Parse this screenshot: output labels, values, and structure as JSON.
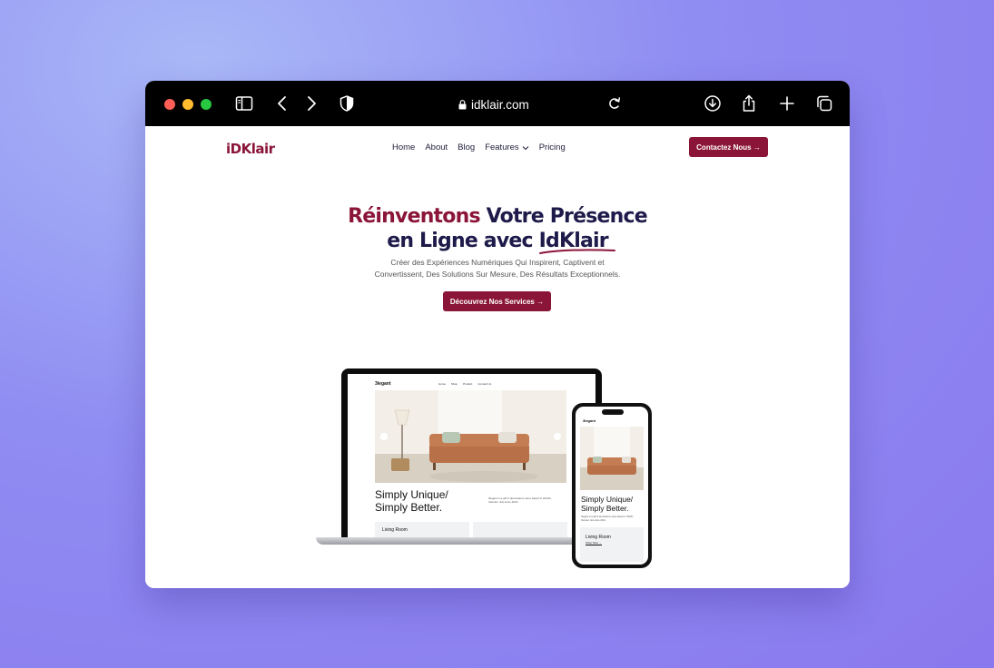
{
  "browser": {
    "url": "idklair.com",
    "traffic_lights": {
      "close": "#ff5f57",
      "minimize": "#febc2e",
      "zoom": "#28c840"
    }
  },
  "site": {
    "logo": "iDKlair",
    "nav": {
      "home": "Home",
      "about": "About",
      "blog": "Blog",
      "features": "Features",
      "pricing": "Pricing"
    },
    "cta_top": "Contactez Nous →",
    "hero": {
      "title_accent": "Réinventons",
      "title_rest_line1": " Votre Présence",
      "title_line2": "en Ligne avec IdKlair",
      "subtitle_line1": "Créer des Expériences Numériques Qui Inspirent, Captivent et",
      "subtitle_line2": "Convertissent, Des Solutions Sur Mesure, Des Résultats Exceptionnels.",
      "cta": "Découvrez Nos Services →"
    },
    "accent_color": "#8b1539",
    "navy_color": "#1e1a4a"
  },
  "mockup": {
    "laptop": {
      "logo": "3legant",
      "nav": [
        "Home",
        "Shop",
        "Product",
        "Contact Us"
      ],
      "headline_line1": "Simply Unique/",
      "headline_line2": "Simply Better.",
      "blurb": "3legant is a gift & decorations store based in HCMC, Vietnam. Est since 2019.",
      "card_label": "Living Room"
    },
    "phone": {
      "logo": "3legant",
      "headline_line1": "Simply Unique/",
      "headline_line2": "Simply Better.",
      "blurb": "3legant is a gift & decorations store based in HCMC, Vietnam. Est since 2019.",
      "card_label": "Living Room",
      "card_link": "Shop Now →"
    }
  }
}
